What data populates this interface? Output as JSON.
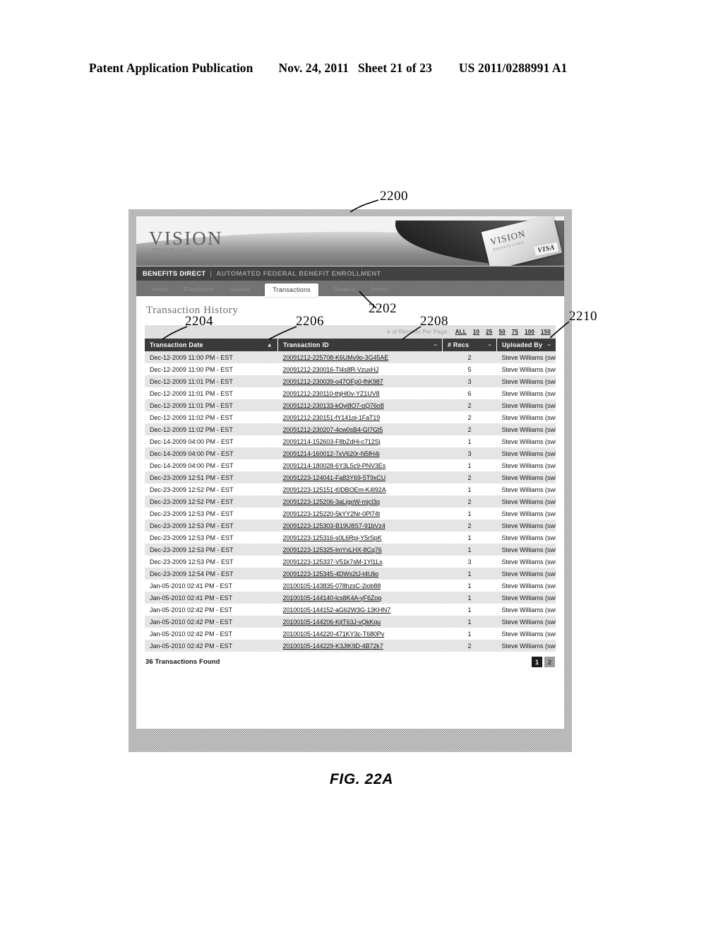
{
  "patent_header": {
    "publication": "Patent Application Publication",
    "date": "Nov. 24, 2011",
    "sheet": "Sheet 21 of 23",
    "number": "US 2011/0288991 A1"
  },
  "figure": {
    "caption": "FIG. 22A",
    "callouts": [
      {
        "id": "2200",
        "label": "2200"
      },
      {
        "id": "2202",
        "label": "2202"
      },
      {
        "id": "2204",
        "label": "2204"
      },
      {
        "id": "2206",
        "label": "2206"
      },
      {
        "id": "2208",
        "label": "2208"
      },
      {
        "id": "2210",
        "label": "2210"
      }
    ]
  },
  "app": {
    "banner": {
      "logo": "VISION",
      "logo_sub": "PREPAID CARD",
      "card_label": "VISION",
      "card_sub": "PREPAID CARD",
      "card_network": "VISA"
    },
    "brand_bar": {
      "brand": "BENEFITS DIRECT",
      "separator": "|",
      "tagline": "AUTOMATED FEDERAL BENEFIT ENROLLMENT"
    },
    "nav": {
      "items": [
        {
          "label": "Home",
          "active": false
        },
        {
          "label": "Enrollment",
          "active": false
        },
        {
          "label": "Upload",
          "active": false
        },
        {
          "label": "Transactions",
          "active": true
        },
        {
          "label": "Reports",
          "active": false
        },
        {
          "label": "Admin",
          "active": false
        }
      ]
    },
    "page": {
      "title": "Transaction History"
    },
    "records_per_page": {
      "label": "# of Records Per Page:",
      "options": [
        "ALL",
        "10",
        "25",
        "50",
        "75",
        "100",
        "150"
      ]
    },
    "table": {
      "columns": [
        {
          "label": "Transaction Date",
          "sort": "asc"
        },
        {
          "label": "Transaction ID",
          "sort": "none"
        },
        {
          "label": "# Recs",
          "sort": "none"
        },
        {
          "label": "Uploaded By",
          "sort": "none"
        }
      ],
      "sort_glyph_asc": "▲",
      "sort_glyph_none": "–",
      "rows": [
        {
          "date": "Dec-12-2009 11:00 PM - EST",
          "id": "20091212-225708-K6UMv9o-3G45AE",
          "recs": "2",
          "by": "Steve Williams (swilliams)"
        },
        {
          "date": "Dec-12-2009 11:00 PM - EST",
          "id": "20091212-230016-Tl4s8R-VzuxHJ",
          "recs": "5",
          "by": "Steve Williams (swilliams)"
        },
        {
          "date": "Dec-12-2009 11:01 PM - EST",
          "id": "20091212-230039-o47OFp0-fhK987",
          "recs": "3",
          "by": "Steve Williams (swilliams)"
        },
        {
          "date": "Dec-12-2009 11:01 PM - EST",
          "id": "20091212-230110-thjHl0v-YZ1UV8",
          "recs": "6",
          "by": "Steve Williams (swilliams)"
        },
        {
          "date": "Dec-12-2009 11:01 PM - EST",
          "id": "20091212-230133-kOyi8O7-oQ76o8",
          "recs": "2",
          "by": "Steve Williams (swilliams)"
        },
        {
          "date": "Dec-12-2009 11:02 PM - EST",
          "id": "20091212-230151-fY141oi-1FaT19",
          "recs": "2",
          "by": "Steve Williams (swilliams)"
        },
        {
          "date": "Dec-12-2009 11:02 PM - EST",
          "id": "20091212-230207-4cw0sB4-GI7Gt5",
          "recs": "2",
          "by": "Steve Williams (swilliams)"
        },
        {
          "date": "Dec-14-2009 04:00 PM - EST",
          "id": "20091214-152603-F8bZdHi-c712Sj",
          "recs": "1",
          "by": "Steve Williams (swilliams)"
        },
        {
          "date": "Dec-14-2009 04:00 PM - EST",
          "id": "20091214-160012-7xV620r-N5fH4i",
          "recs": "3",
          "by": "Steve Williams (swilliams)"
        },
        {
          "date": "Dec-14-2009 04:00 PM - EST",
          "id": "20091214-180028-6Y3L5c9-PNV3Es",
          "recs": "1",
          "by": "Steve Williams (swilliams)"
        },
        {
          "date": "Dec-23-2009 12:51 PM - EST",
          "id": "20091223-124041-Fa83Y69-5T9xCU",
          "recs": "2",
          "by": "Steve Williams (swilliams)"
        },
        {
          "date": "Dec-23-2009 12:52 PM - EST",
          "id": "20091223-125151-t0DBOEm-K4I92A",
          "recs": "1",
          "by": "Steve Williams (swilliams)"
        },
        {
          "date": "Dec-23-2009 12:52 PM - EST",
          "id": "20091223-125206-3aLigoW-mjcl3q",
          "recs": "2",
          "by": "Steve Williams (swilliams)"
        },
        {
          "date": "Dec-23-2009 12:53 PM - EST",
          "id": "20091223-125220-5kYY2Nr-0Pl74t",
          "recs": "1",
          "by": "Steve Williams (swilliams)"
        },
        {
          "date": "Dec-23-2009 12:53 PM - EST",
          "id": "20091223-125303-B19U8S7-91bVz4",
          "recs": "2",
          "by": "Steve Williams (swilliams)"
        },
        {
          "date": "Dec-23-2009 12:53 PM - EST",
          "id": "20091223-125316-s0L6Rpj-Y5rSpK",
          "recs": "1",
          "by": "Steve Williams (swilliams)"
        },
        {
          "date": "Dec-23-2009 12:53 PM - EST",
          "id": "20091223-125325-lmYxLHX-8Cq76",
          "recs": "1",
          "by": "Steve Williams (swilliams)"
        },
        {
          "date": "Dec-23-2009 12:53 PM - EST",
          "id": "20091223-125337-V51k7sM-1Yl1Lx",
          "recs": "3",
          "by": "Steve Williams (swilliams)"
        },
        {
          "date": "Dec-23-2009 12:54 PM - EST",
          "id": "20091223-125345-4DWs2tJ-t4Ulio",
          "recs": "1",
          "by": "Steve Williams (swilliams)"
        },
        {
          "date": "Jan-05-2010 02:41 PM - EST",
          "id": "20100105-143835-078hzsC-2iob88",
          "recs": "1",
          "by": "Steve Williams (swilliams)"
        },
        {
          "date": "Jan-05-2010 02:41 PM - EST",
          "id": "20100105-144140-lcs8K4A-yF6Zoq",
          "recs": "1",
          "by": "Steve Williams (swilliams)"
        },
        {
          "date": "Jan-05-2010 02:42 PM - EST",
          "id": "20100105-144152-aG62W3G-13KHN7",
          "recs": "1",
          "by": "Steve Williams (swilliams)"
        },
        {
          "date": "Jan-05-2010 02:42 PM - EST",
          "id": "20100105-144206-KjtT63J-vQkKqu",
          "recs": "1",
          "by": "Steve Williams (swilliams)"
        },
        {
          "date": "Jan-05-2010 02:42 PM - EST",
          "id": "20100105-144220-471KY3c-T680Pv",
          "recs": "1",
          "by": "Steve Williams (swilliams)"
        },
        {
          "date": "Jan-05-2010 02:42 PM - EST",
          "id": "20100105-144229-K3JtK9D-4B72k7",
          "recs": "2",
          "by": "Steve Williams (swilliams)"
        }
      ]
    },
    "footer": {
      "found_count": "36 Transactions Found",
      "pages": [
        {
          "label": "1",
          "current": true
        },
        {
          "label": "2",
          "current": false
        }
      ]
    }
  }
}
